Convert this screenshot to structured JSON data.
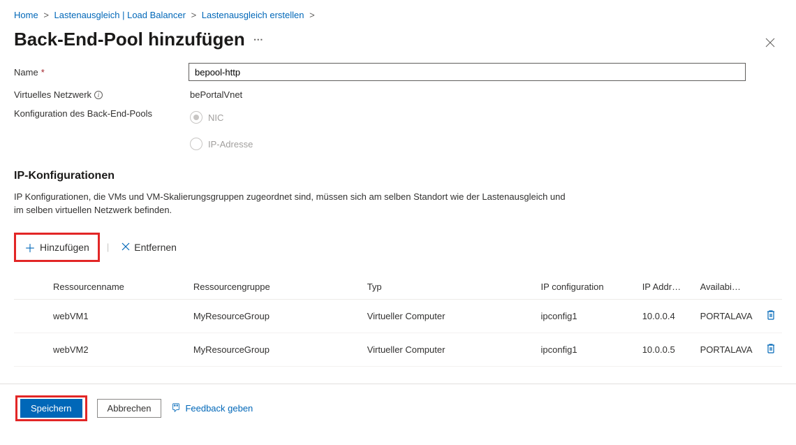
{
  "breadcrumb": {
    "home": "Home",
    "lb": "Lastenausgleich | Load Balancer",
    "create": "Lastenausgleich erstellen"
  },
  "page": {
    "title": "Back-End-Pool hinzufügen"
  },
  "form": {
    "name_label": "Name",
    "name_value": "bepool-http",
    "vnet_label": "Virtuelles Netzwerk",
    "vnet_value": "bePortalVnet",
    "config_label": "Konfiguration des Back-End-Pools",
    "radio_nic": "NIC",
    "radio_ip": "IP-Adresse"
  },
  "ipcfg": {
    "section_title": "IP-Konfigurationen",
    "description": "IP Konfigurationen, die VMs und VM-Skalierungsgruppen zugeordnet sind, müssen sich am selben Standort wie der Lastenausgleich und im selben virtuellen Netzwerk befinden.",
    "add_label": "Hinzufügen",
    "remove_label": "Entfernen",
    "headers": {
      "resource": "Ressourcenname",
      "rg": "Ressourcengruppe",
      "type": "Typ",
      "ipconfig": "IP configuration",
      "ipaddr": "IP Addr…",
      "avail": "Availabi…"
    },
    "rows": [
      {
        "resource": "webVM1",
        "rg": "MyResourceGroup",
        "type": "Virtueller Computer",
        "ipconfig": "ipconfig1",
        "ipaddr": "10.0.0.4",
        "avail": "PORTALAVA"
      },
      {
        "resource": "webVM2",
        "rg": "MyResourceGroup",
        "type": "Virtueller Computer",
        "ipconfig": "ipconfig1",
        "ipaddr": "10.0.0.5",
        "avail": "PORTALAVA"
      }
    ]
  },
  "footer": {
    "save": "Speichern",
    "cancel": "Abbrechen",
    "feedback": "Feedback geben"
  }
}
